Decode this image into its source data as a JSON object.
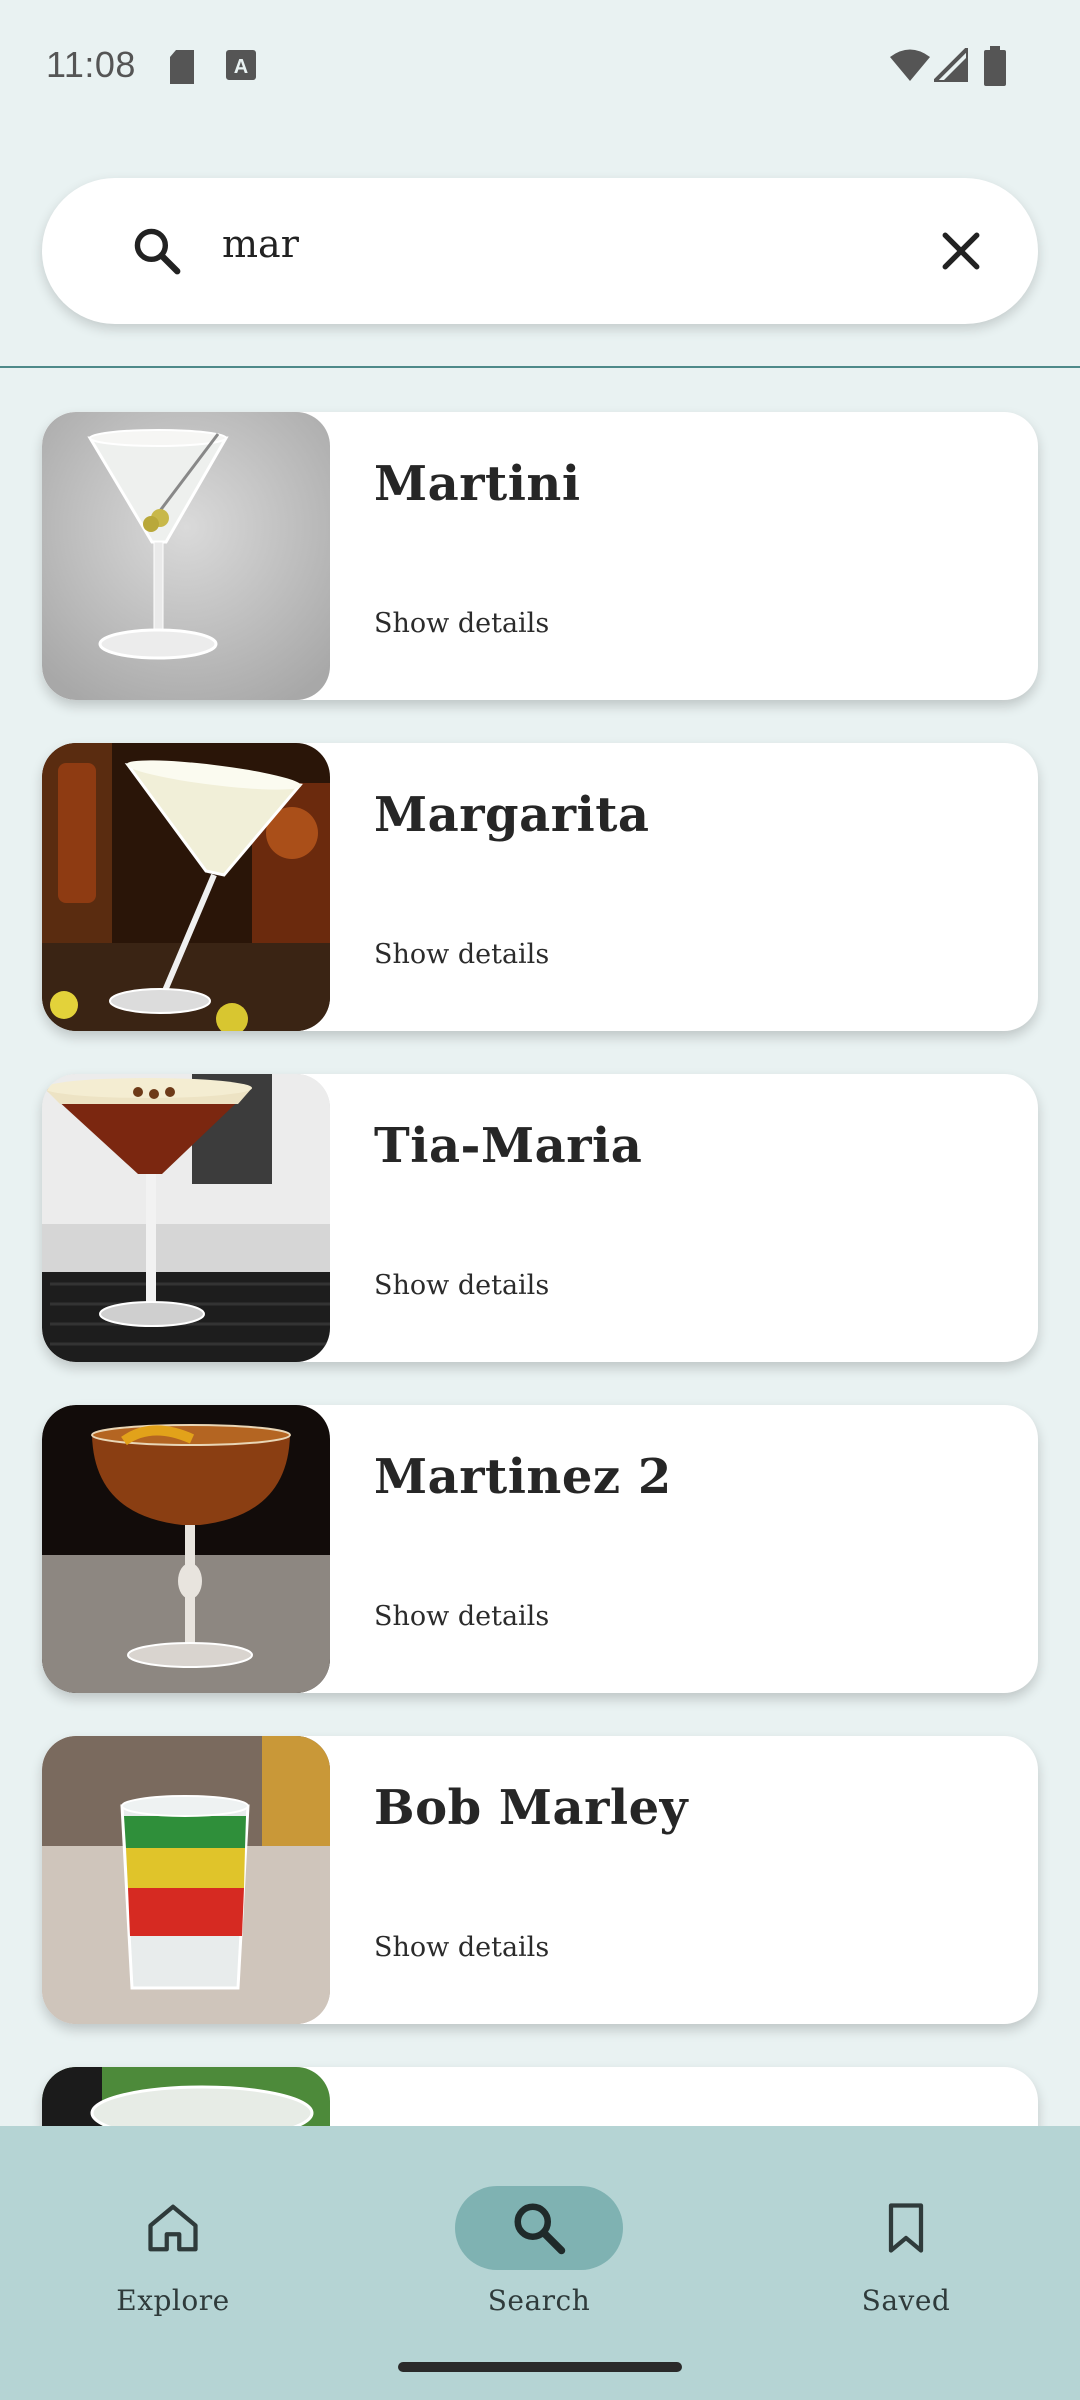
{
  "status_bar": {
    "time": "11:08",
    "icons": [
      "sd-card-icon",
      "keyboard-a-icon",
      "wifi-icon",
      "signal-icon",
      "battery-icon"
    ]
  },
  "search": {
    "value": "mar",
    "icon": "search-icon",
    "clear_icon": "close-icon"
  },
  "results": [
    {
      "name": "Martini",
      "link": "Show details"
    },
    {
      "name": "Margarita",
      "link": "Show details"
    },
    {
      "name": "Tia-Maria",
      "link": "Show details"
    },
    {
      "name": "Martinez 2",
      "link": "Show details"
    },
    {
      "name": "Bob Marley",
      "link": "Show details"
    }
  ],
  "bottom_nav": {
    "items": [
      {
        "label": "Explore",
        "icon": "home-icon",
        "active": false
      },
      {
        "label": "Search",
        "icon": "search-icon",
        "active": true
      },
      {
        "label": "Saved",
        "icon": "bookmark-icon",
        "active": false
      }
    ]
  },
  "colors": {
    "background": "#e9f2f2",
    "nav_background": "#b5d4d4",
    "nav_active_pill": "#7fb2b2",
    "divider": "#4e8a8a"
  }
}
